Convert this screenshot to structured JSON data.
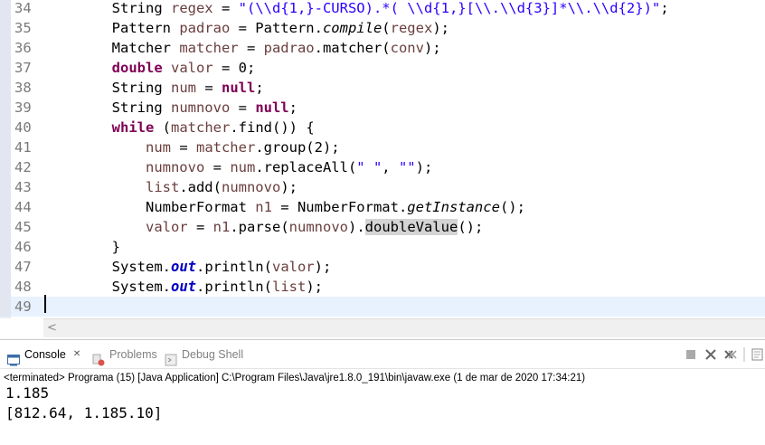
{
  "editor": {
    "lines": [
      {
        "num": "34",
        "segments": [
          [
            "",
            "        String "
          ],
          [
            "var",
            "regex"
          ],
          [
            "",
            " = "
          ],
          [
            "str",
            "\"(\\\\d{1,}-CURSO).*( \\\\d{1,}[\\\\.\\\\d{3}]*\\\\.\\\\d{2})\""
          ],
          [
            "",
            ";"
          ]
        ]
      },
      {
        "num": "35",
        "segments": [
          [
            "",
            "        Pattern "
          ],
          [
            "var",
            "padrao"
          ],
          [
            "",
            " = Pattern."
          ],
          [
            "it",
            "compile"
          ],
          [
            "",
            "("
          ],
          [
            "var",
            "regex"
          ],
          [
            "",
            ");"
          ]
        ]
      },
      {
        "num": "36",
        "segments": [
          [
            "",
            "        Matcher "
          ],
          [
            "var",
            "matcher"
          ],
          [
            "",
            " = "
          ],
          [
            "var",
            "padrao"
          ],
          [
            "",
            ".matcher("
          ],
          [
            "var",
            "conv"
          ],
          [
            "",
            ");"
          ]
        ]
      },
      {
        "num": "37",
        "segments": [
          [
            "kw",
            "        double"
          ],
          [
            "",
            " "
          ],
          [
            "var",
            "valor"
          ],
          [
            "",
            " = 0;"
          ]
        ]
      },
      {
        "num": "38",
        "segments": [
          [
            "",
            "        String "
          ],
          [
            "var",
            "num"
          ],
          [
            "",
            " = "
          ],
          [
            "kw",
            "null"
          ],
          [
            "",
            ";"
          ]
        ]
      },
      {
        "num": "39",
        "segments": [
          [
            "",
            "        String "
          ],
          [
            "var",
            "numnovo"
          ],
          [
            "",
            " = "
          ],
          [
            "kw",
            "null"
          ],
          [
            "",
            ";"
          ]
        ]
      },
      {
        "num": "40",
        "segments": [
          [
            "kw",
            "        while"
          ],
          [
            "",
            " ("
          ],
          [
            "var",
            "matcher"
          ],
          [
            "",
            ".find()) {"
          ]
        ]
      },
      {
        "num": "41",
        "segments": [
          [
            "",
            "            "
          ],
          [
            "var",
            "num"
          ],
          [
            "",
            " = "
          ],
          [
            "var",
            "matcher"
          ],
          [
            "",
            ".group(2);"
          ]
        ]
      },
      {
        "num": "42",
        "segments": [
          [
            "",
            "            "
          ],
          [
            "var",
            "numnovo"
          ],
          [
            "",
            " = "
          ],
          [
            "var",
            "num"
          ],
          [
            "",
            ".replaceAll("
          ],
          [
            "str",
            "\" \""
          ],
          [
            "",
            ", "
          ],
          [
            "str",
            "\"\""
          ],
          [
            "",
            ");"
          ]
        ]
      },
      {
        "num": "43",
        "segments": [
          [
            "",
            "            "
          ],
          [
            "var",
            "list"
          ],
          [
            "",
            ".add("
          ],
          [
            "var",
            "numnovo"
          ],
          [
            "",
            ");"
          ]
        ]
      },
      {
        "num": "44",
        "segments": [
          [
            "",
            "            NumberFormat "
          ],
          [
            "var",
            "n1"
          ],
          [
            "",
            " = NumberFormat."
          ],
          [
            "it",
            "getInstance"
          ],
          [
            "",
            "();"
          ]
        ]
      },
      {
        "num": "45",
        "segments": [
          [
            "",
            "            "
          ],
          [
            "var",
            "valor"
          ],
          [
            "",
            " = "
          ],
          [
            "var",
            "n1"
          ],
          [
            "",
            ".parse("
          ],
          [
            "var",
            "numnovo"
          ],
          [
            "",
            ")."
          ],
          [
            "hl",
            "doubleValue"
          ],
          [
            "",
            "();"
          ]
        ]
      },
      {
        "num": "46",
        "segments": [
          [
            "",
            "        }"
          ]
        ]
      },
      {
        "num": "47",
        "segments": [
          [
            "",
            "        System."
          ],
          [
            "fld",
            "out"
          ],
          [
            "",
            ".println("
          ],
          [
            "var",
            "valor"
          ],
          [
            "",
            ");"
          ]
        ]
      },
      {
        "num": "48",
        "segments": [
          [
            "",
            "        System."
          ],
          [
            "fld",
            "out"
          ],
          [
            "",
            ".println("
          ],
          [
            "var",
            "list"
          ],
          [
            "",
            ");"
          ]
        ]
      },
      {
        "num": "49",
        "segments": []
      }
    ],
    "current_line": "49"
  },
  "views": {
    "tabs": [
      {
        "label": "Console",
        "icon": "console-icon",
        "active": true
      },
      {
        "label": "Problems",
        "icon": "problems-icon",
        "active": false
      },
      {
        "label": "Debug Shell",
        "icon": "debug-shell-icon",
        "active": false
      }
    ],
    "close_glyph": "✕"
  },
  "console": {
    "status": "<terminated> Programa (15) [Java Application] C:\\Program Files\\Java\\jre1.8.0_191\\bin\\javaw.exe (1 de mar de 2020 17:34:21)",
    "output": [
      "1.185",
      "[812.64, 1.185.10]"
    ]
  },
  "colors": {
    "keyword": "#7f0055",
    "variable": "#6a3e3e",
    "string": "#2a00ff",
    "field": "#0000c0",
    "current_line": "#e8f2fe"
  }
}
